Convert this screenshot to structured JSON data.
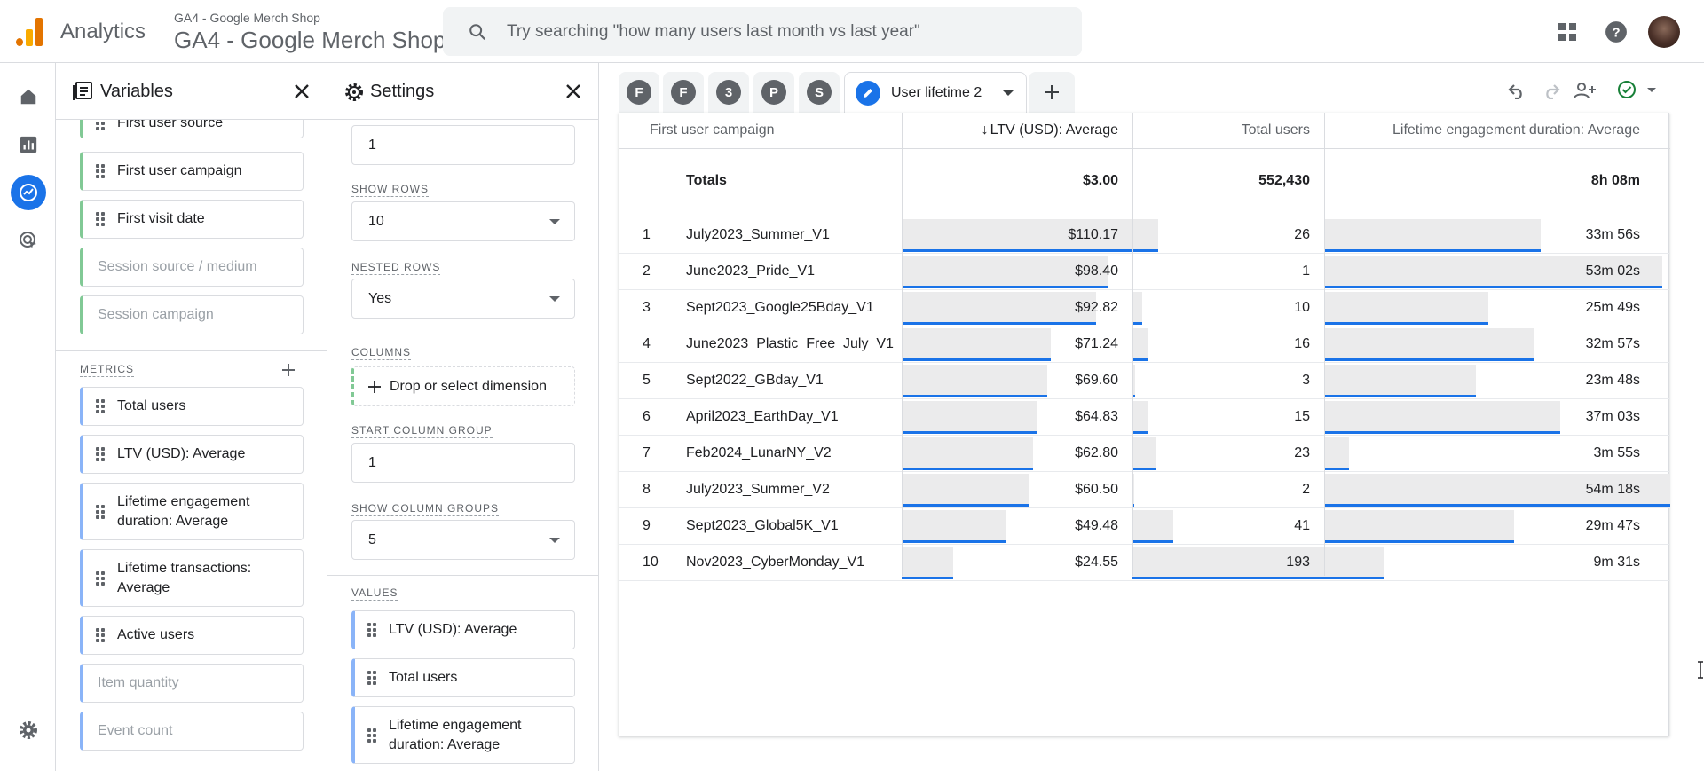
{
  "app": {
    "name": "Analytics",
    "property_subtitle": "GA4 - Google Merch Shop",
    "property_name": "GA4 - Google Merch Shop",
    "search_placeholder": "Try searching \"how many users last month vs last year\""
  },
  "colors": {
    "accent": "#1a73e8",
    "dimension_chip": "#81c995",
    "metric_chip": "#8ab4f8",
    "bar_fill": "#ebebec",
    "logo": [
      "#f9ab00",
      "#e37400"
    ]
  },
  "variables_panel": {
    "title": "Variables",
    "dimensions": [
      {
        "label": "First user source",
        "active": true
      },
      {
        "label": "First user campaign",
        "active": true
      },
      {
        "label": "First visit date",
        "active": true
      },
      {
        "label": "Session source / medium",
        "active": false
      },
      {
        "label": "Session campaign",
        "active": false
      }
    ],
    "metrics_label": "METRICS",
    "metrics": [
      {
        "label": "Total users",
        "active": true
      },
      {
        "label": "LTV (USD): Average",
        "active": true
      },
      {
        "label": "Lifetime engagement duration: Average",
        "active": true
      },
      {
        "label": "Lifetime transactions: Average",
        "active": true
      },
      {
        "label": "Active users",
        "active": true
      },
      {
        "label": "Item quantity",
        "active": false
      },
      {
        "label": "Event count",
        "active": false
      }
    ]
  },
  "settings_panel": {
    "title": "Settings",
    "start_row_value": "1",
    "show_rows_label": "SHOW ROWS",
    "show_rows_value": "10",
    "nested_rows_label": "NESTED ROWS",
    "nested_rows_value": "Yes",
    "columns_label": "COLUMNS",
    "columns_drop": "Drop or select dimension",
    "start_column_group_label": "START COLUMN GROUP",
    "start_column_group_value": "1",
    "show_column_groups_label": "SHOW COLUMN GROUPS",
    "show_column_groups_value": "5",
    "values_label": "VALUES",
    "values": [
      "LTV (USD): Average",
      "Total users",
      "Lifetime engagement duration: Average"
    ]
  },
  "tabs": {
    "circles": [
      "F",
      "F",
      "3",
      "P",
      "S"
    ],
    "active_label": "User lifetime 2"
  },
  "table": {
    "headers": {
      "dimension": "First user campaign",
      "ltv": "LTV (USD): Average",
      "users": "Total users",
      "engagement": "Lifetime engagement duration: Average"
    },
    "sort_indicator": "↓",
    "totals": {
      "label": "Totals",
      "ltv": "$3.00",
      "users": "552,430",
      "engagement": "8h 08m"
    },
    "rows": [
      {
        "idx": "1",
        "campaign": "July2023_Summer_V1",
        "ltv": "$110.17",
        "users": "26",
        "engagement": "33m 56s",
        "ltv_v": 110.17,
        "users_v": 26,
        "eng_v": 2036
      },
      {
        "idx": "2",
        "campaign": "June2023_Pride_V1",
        "ltv": "$98.40",
        "users": "1",
        "engagement": "53m 02s",
        "ltv_v": 98.4,
        "users_v": 1,
        "eng_v": 3182
      },
      {
        "idx": "3",
        "campaign": "Sept2023_Google25Bday_V1",
        "ltv": "$92.82",
        "users": "10",
        "engagement": "25m 49s",
        "ltv_v": 92.82,
        "users_v": 10,
        "eng_v": 1549
      },
      {
        "idx": "4",
        "campaign": "June2023_Plastic_Free_July_V1",
        "ltv": "$71.24",
        "users": "16",
        "engagement": "32m 57s",
        "ltv_v": 71.24,
        "users_v": 16,
        "eng_v": 1977
      },
      {
        "idx": "5",
        "campaign": "Sept2022_GBday_V1",
        "ltv": "$69.60",
        "users": "3",
        "engagement": "23m 48s",
        "ltv_v": 69.6,
        "users_v": 3,
        "eng_v": 1428
      },
      {
        "idx": "6",
        "campaign": "April2023_EarthDay_V1",
        "ltv": "$64.83",
        "users": "15",
        "engagement": "37m 03s",
        "ltv_v": 64.83,
        "users_v": 15,
        "eng_v": 2223
      },
      {
        "idx": "7",
        "campaign": "Feb2024_LunarNY_V2",
        "ltv": "$62.80",
        "users": "23",
        "engagement": "3m 55s",
        "ltv_v": 62.8,
        "users_v": 23,
        "eng_v": 235
      },
      {
        "idx": "8",
        "campaign": "July2023_Summer_V2",
        "ltv": "$60.50",
        "users": "2",
        "engagement": "54m 18s",
        "ltv_v": 60.5,
        "users_v": 2,
        "eng_v": 3258
      },
      {
        "idx": "9",
        "campaign": "Sept2023_Global5K_V1",
        "ltv": "$49.48",
        "users": "41",
        "engagement": "29m 47s",
        "ltv_v": 49.48,
        "users_v": 41,
        "eng_v": 1787
      },
      {
        "idx": "10",
        "campaign": "Nov2023_CyberMonday_V1",
        "ltv": "$24.55",
        "users": "193",
        "engagement": "9m 31s",
        "ltv_v": 24.55,
        "users_v": 193,
        "eng_v": 571
      }
    ]
  }
}
